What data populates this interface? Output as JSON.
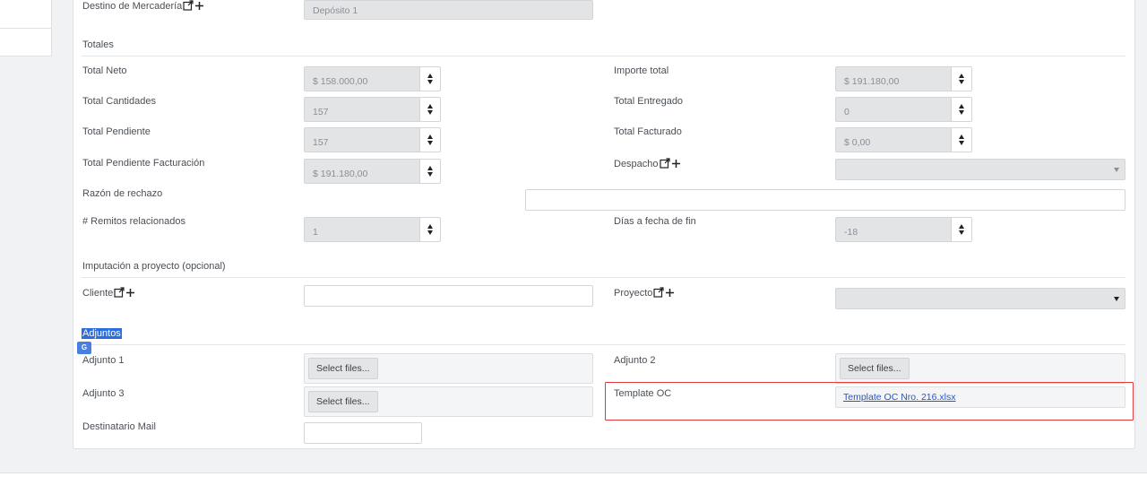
{
  "top": {
    "destino_label": "Destino de Mercadería",
    "destino_value": "Depósito 1"
  },
  "totales": {
    "title": "Totales",
    "total_neto_label": "Total Neto",
    "total_neto_value": "$ 158.000,00",
    "importe_total_label": "Importe total",
    "importe_total_value": "$ 191.180,00",
    "total_cantidades_label": "Total Cantidades",
    "total_cantidades_value": "157",
    "total_entregado_label": "Total Entregado",
    "total_entregado_value": "0",
    "total_pendiente_label": "Total Pendiente",
    "total_pendiente_value": "157",
    "total_facturado_label": "Total Facturado",
    "total_facturado_value": "$ 0,00",
    "pendiente_fact_label": "Total Pendiente Facturación",
    "pendiente_fact_value": "$ 191.180,00",
    "despacho_label": "Despacho",
    "razon_label": "Razón de rechazo",
    "remitos_label": "# Remitos relacionados",
    "remitos_value": "1",
    "dias_label": "Días a fecha de fin",
    "dias_value": "-18"
  },
  "imputacion": {
    "title": "Imputación a proyecto (opcional)",
    "cliente_label": "Cliente",
    "proyecto_label": "Proyecto"
  },
  "adjuntos": {
    "title": "Adjuntos",
    "adjunto1_label": "Adjunto 1",
    "adjunto2_label": "Adjunto 2",
    "adjunto3_label": "Adjunto 3",
    "select_files": "Select files...",
    "template_label": "Template OC",
    "template_link": "Template OC Nro. 216.xlsx",
    "destinatario_label": "Destinatario Mail"
  },
  "icons": {
    "external": "external-link-icon",
    "plus": "plus-icon",
    "translate": "google-translate-icon"
  },
  "colors": {
    "highlight": "#2c6ee0",
    "link": "#2a55c8",
    "frame": "#e23b3b"
  }
}
